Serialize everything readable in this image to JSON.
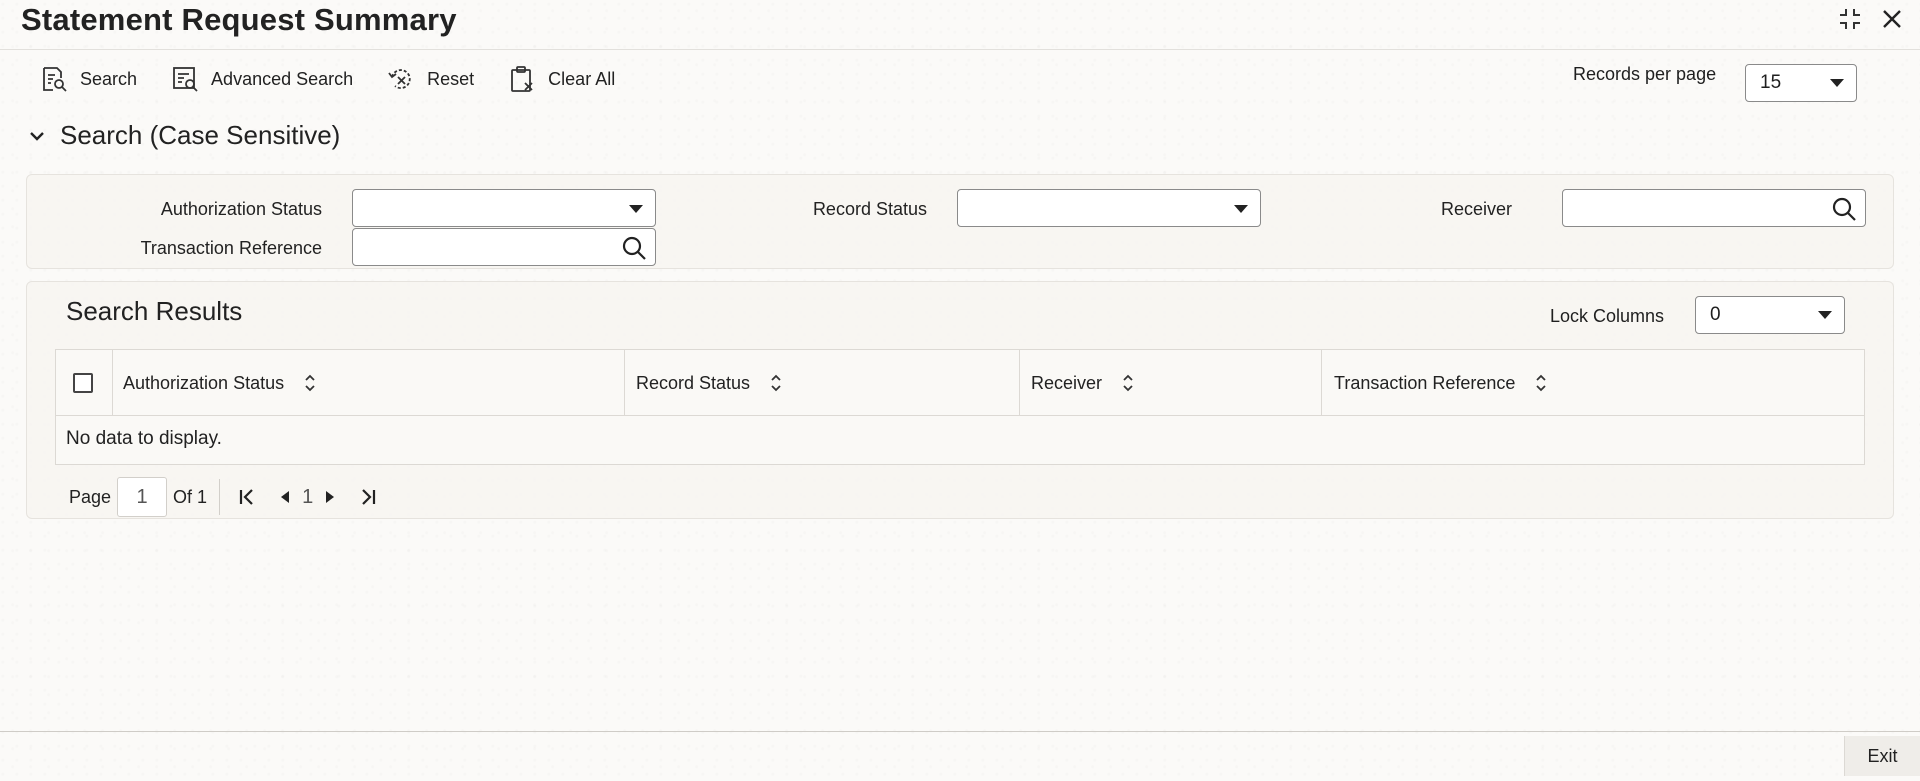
{
  "window": {
    "title": "Statement Request Summary"
  },
  "toolbar": {
    "search_label": "Search",
    "advanced_search_label": "Advanced Search",
    "reset_label": "Reset",
    "clear_all_label": "Clear All"
  },
  "records_per_page": {
    "label": "Records per page",
    "value": "15"
  },
  "search_section": {
    "title": "Search (Case Sensitive)",
    "fields": {
      "authorization_status": {
        "label": "Authorization Status",
        "value": ""
      },
      "record_status": {
        "label": "Record Status",
        "value": ""
      },
      "receiver": {
        "label": "Receiver",
        "value": ""
      },
      "transaction_reference": {
        "label": "Transaction Reference",
        "value": ""
      }
    }
  },
  "results": {
    "title": "Search Results",
    "lock_columns": {
      "label": "Lock Columns",
      "value": "0"
    },
    "columns": [
      "Authorization Status",
      "Record Status",
      "Receiver",
      "Transaction Reference"
    ],
    "empty_message": "No data to display."
  },
  "pagination": {
    "page_label": "Page",
    "current_page": "1",
    "of_label": "Of 1",
    "page_number": "1"
  },
  "footer": {
    "exit_label": "Exit"
  }
}
